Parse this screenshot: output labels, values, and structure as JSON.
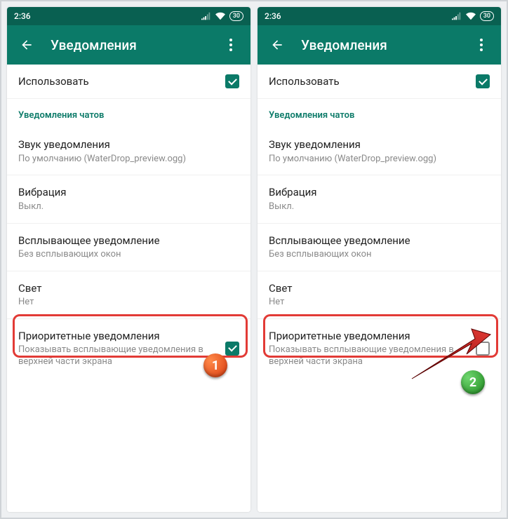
{
  "statusTime": "2:36",
  "batteryText": "30",
  "appTitle": "Уведомления",
  "useLabel": "Использовать",
  "sectionChat": "Уведомления чатов",
  "soundTitle": "Звук уведомления",
  "soundSub": "По умолчанию (WaterDrop_preview.ogg)",
  "vibTitle": "Вибрация",
  "vibSub": "Выкл.",
  "popupTitle": "Всплывающее уведомление",
  "popupSub": "Без всплывающих окон",
  "lightTitle": "Свет",
  "lightSub": "Нет",
  "priorityTitle": "Приоритетные уведомления",
  "prioritySub": "Показывать всплывающие уведомления в верхней части экрана",
  "step1": "1",
  "step2": "2"
}
